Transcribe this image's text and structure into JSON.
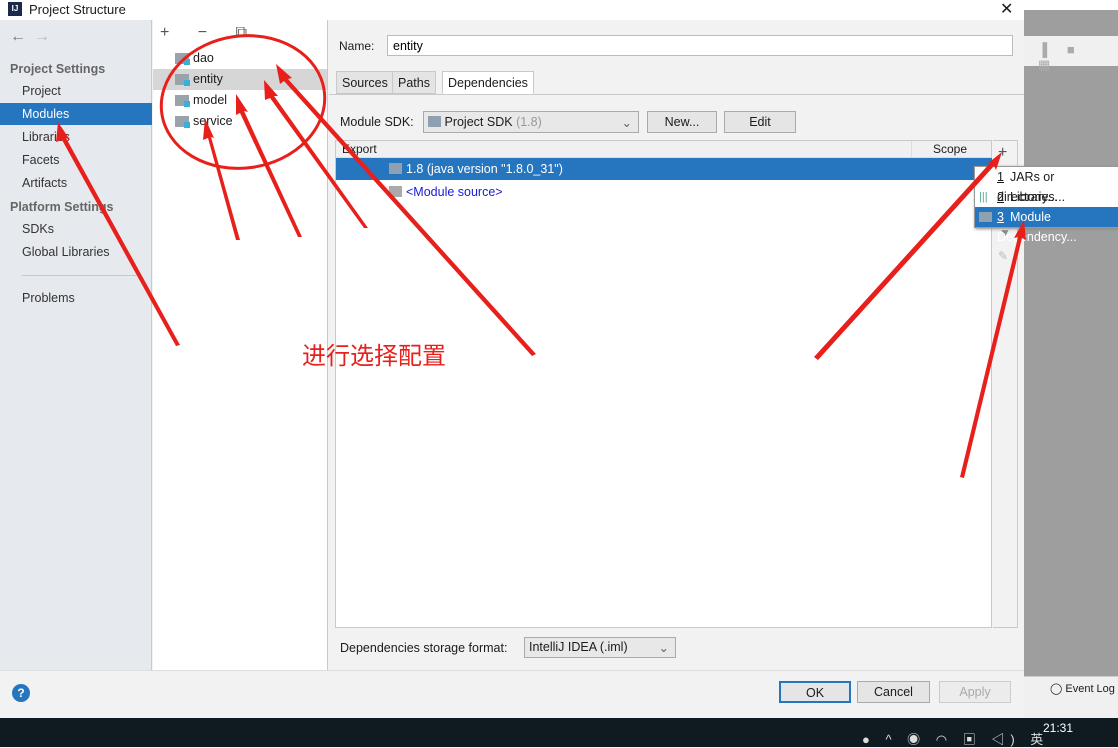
{
  "window": {
    "title": "Project Structure",
    "close": "✕"
  },
  "sidebar": {
    "back": "←",
    "forward": "→",
    "sections": [
      {
        "title": "Project Settings",
        "items": [
          {
            "label": "Project"
          },
          {
            "label": "Modules",
            "selected": true
          },
          {
            "label": "Libraries"
          },
          {
            "label": "Facets"
          },
          {
            "label": "Artifacts"
          }
        ]
      },
      {
        "title": "Platform Settings",
        "items": [
          {
            "label": "SDKs"
          },
          {
            "label": "Global Libraries"
          }
        ]
      }
    ],
    "problems": "Problems"
  },
  "modules": {
    "tools": "+ − ⧉",
    "items": [
      "dao",
      "entity",
      "model",
      "service"
    ],
    "selected": "entity"
  },
  "main": {
    "name_label": "Name:",
    "name_value": "entity",
    "tabs": [
      "Sources",
      "Paths",
      "Dependencies"
    ],
    "active_tab": "Dependencies",
    "sdk_label": "Module SDK:",
    "sdk_value": "Project SDK",
    "sdk_version": "(1.8)",
    "new_button": "New...",
    "edit_button": "Edit",
    "columns": {
      "export": "Export",
      "scope": "Scope"
    },
    "rows": [
      "1.8 (java version \"1.8.0_31\")",
      "<Module source>"
    ],
    "add": "+",
    "popup": [
      {
        "num": "1",
        "label": "JARs or directories..."
      },
      {
        "num": "2",
        "label": "Library..."
      },
      {
        "num": "3",
        "label": "Module Dependency..."
      }
    ],
    "format_label": "Dependencies storage format:",
    "format_value": "IntelliJ IDEA (.iml)"
  },
  "buttons": {
    "ok": "OK",
    "cancel": "Cancel",
    "apply": "Apply",
    "help": "?"
  },
  "ide": {
    "event_log": "Event Log"
  },
  "taskbar": {
    "time": "21:31",
    "ime": "英"
  },
  "annotation": {
    "text": "进行选择配置",
    "color": "#e8201c"
  },
  "colors": {
    "accent": "#2675bf"
  }
}
